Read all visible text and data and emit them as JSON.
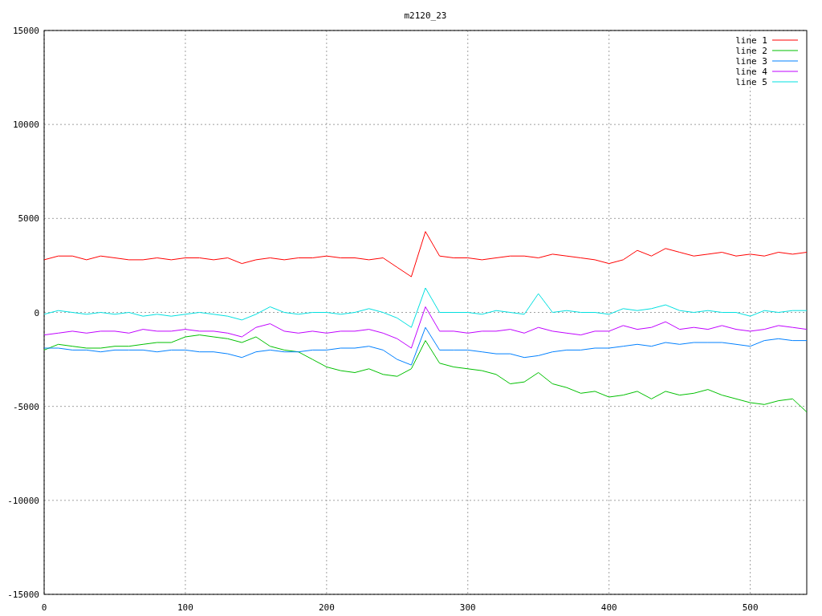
{
  "chart_data": {
    "type": "line",
    "title": "m2120_23",
    "grid": true,
    "legend": true,
    "xlim": [
      0,
      540
    ],
    "ylim": [
      -15000,
      15000
    ],
    "xticks": [
      0,
      100,
      200,
      300,
      400,
      500
    ],
    "yticks": [
      -15000,
      -10000,
      -5000,
      0,
      5000,
      10000,
      15000
    ],
    "x": [
      0,
      10,
      20,
      30,
      40,
      50,
      60,
      70,
      80,
      90,
      100,
      110,
      120,
      130,
      140,
      150,
      160,
      170,
      180,
      190,
      200,
      210,
      220,
      230,
      240,
      250,
      260,
      270,
      280,
      290,
      300,
      310,
      320,
      330,
      340,
      350,
      360,
      370,
      380,
      390,
      400,
      410,
      420,
      430,
      440,
      450,
      460,
      470,
      480,
      490,
      500,
      510,
      520,
      530,
      540
    ],
    "series": [
      {
        "name": "line 1",
        "color": "#ff0000",
        "values": [
          2800,
          3000,
          3000,
          2800,
          3000,
          2900,
          2800,
          2800,
          2900,
          2800,
          2900,
          2900,
          2800,
          2900,
          2600,
          2800,
          2900,
          2800,
          2900,
          2900,
          3000,
          2900,
          2900,
          2800,
          2900,
          2400,
          1900,
          4300,
          3000,
          2900,
          2900,
          2800,
          2900,
          3000,
          3000,
          2900,
          3100,
          3000,
          2900,
          2800,
          2600,
          2800,
          3300,
          3000,
          3400,
          3200,
          3000,
          3100,
          3200,
          3000,
          3100,
          3000,
          3200,
          3100,
          3200
        ]
      },
      {
        "name": "line 2",
        "color": "#00c000",
        "values": [
          -2000,
          -1700,
          -1800,
          -1900,
          -1900,
          -1800,
          -1800,
          -1700,
          -1600,
          -1600,
          -1300,
          -1200,
          -1300,
          -1400,
          -1600,
          -1300,
          -1800,
          -2000,
          -2100,
          -2500,
          -2900,
          -3100,
          -3200,
          -3000,
          -3300,
          -3400,
          -3000,
          -1500,
          -2700,
          -2900,
          -3000,
          -3100,
          -3300,
          -3800,
          -3700,
          -3200,
          -3800,
          -4000,
          -4300,
          -4200,
          -4500,
          -4400,
          -4200,
          -4600,
          -4200,
          -4400,
          -4300,
          -4100,
          -4400,
          -4600,
          -4800,
          -4900,
          -4700,
          -4600,
          -5300
        ]
      },
      {
        "name": "line 3",
        "color": "#0080ff",
        "values": [
          -1900,
          -1900,
          -2000,
          -2000,
          -2100,
          -2000,
          -2000,
          -2000,
          -2100,
          -2000,
          -2000,
          -2100,
          -2100,
          -2200,
          -2400,
          -2100,
          -2000,
          -2100,
          -2100,
          -2000,
          -2000,
          -1900,
          -1900,
          -1800,
          -2000,
          -2500,
          -2800,
          -800,
          -2000,
          -2000,
          -2000,
          -2100,
          -2200,
          -2200,
          -2400,
          -2300,
          -2100,
          -2000,
          -2000,
          -1900,
          -1900,
          -1800,
          -1700,
          -1800,
          -1600,
          -1700,
          -1600,
          -1600,
          -1600,
          -1700,
          -1800,
          -1500,
          -1400,
          -1500,
          -1500
        ]
      },
      {
        "name": "line 4",
        "color": "#c000ff",
        "values": [
          -1200,
          -1100,
          -1000,
          -1100,
          -1000,
          -1000,
          -1100,
          -900,
          -1000,
          -1000,
          -900,
          -1000,
          -1000,
          -1100,
          -1300,
          -800,
          -600,
          -1000,
          -1100,
          -1000,
          -1100,
          -1000,
          -1000,
          -900,
          -1100,
          -1400,
          -1900,
          300,
          -1000,
          -1000,
          -1100,
          -1000,
          -1000,
          -900,
          -1100,
          -800,
          -1000,
          -1100,
          -1200,
          -1000,
          -1000,
          -700,
          -900,
          -800,
          -500,
          -900,
          -800,
          -900,
          -700,
          -900,
          -1000,
          -900,
          -700,
          -800,
          -900
        ]
      },
      {
        "name": "line 5",
        "color": "#00e0e0",
        "values": [
          -100,
          100,
          0,
          -100,
          0,
          -100,
          0,
          -200,
          -100,
          -200,
          -100,
          0,
          -100,
          -200,
          -400,
          -100,
          300,
          0,
          -100,
          0,
          0,
          -100,
          0,
          200,
          0,
          -300,
          -800,
          1300,
          0,
          0,
          0,
          -100,
          100,
          0,
          -100,
          1000,
          0,
          100,
          0,
          0,
          -100,
          200,
          100,
          200,
          400,
          100,
          0,
          100,
          0,
          0,
          -200,
          100,
          0,
          100,
          100
        ]
      }
    ]
  }
}
